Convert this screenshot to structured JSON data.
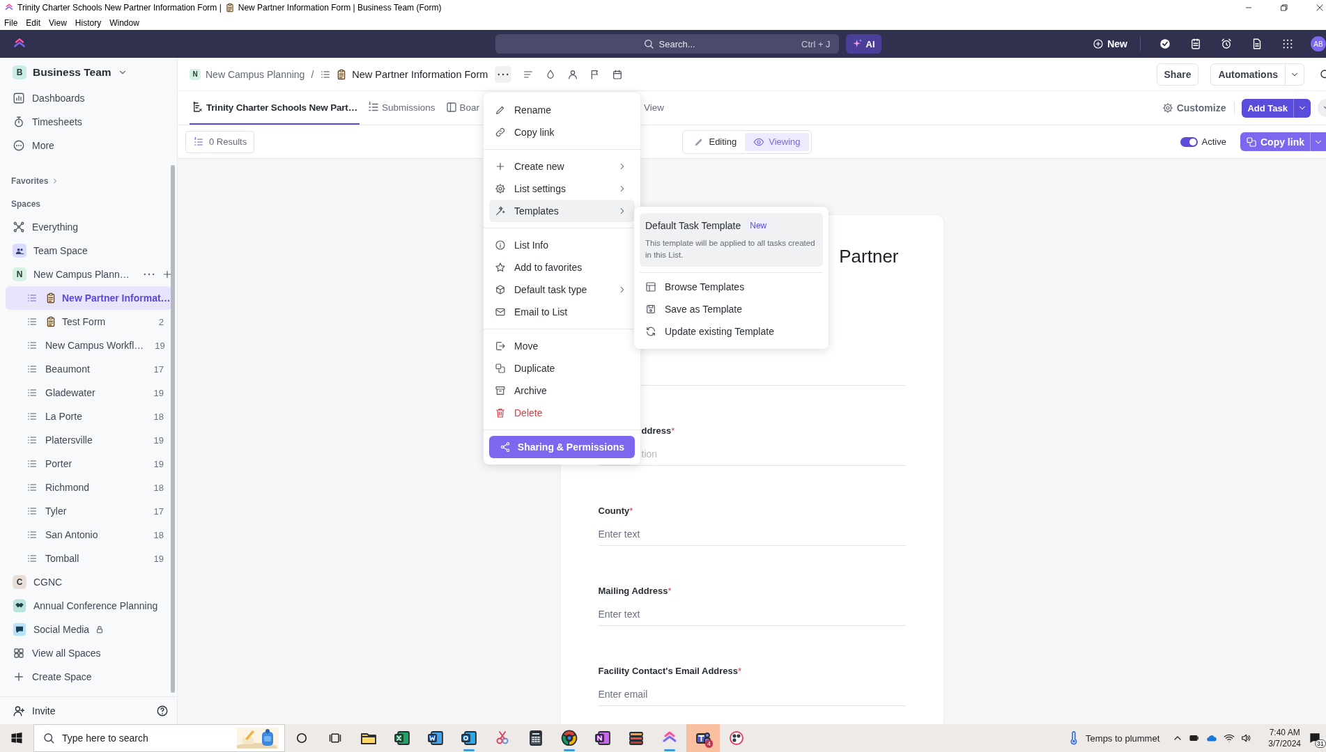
{
  "window": {
    "title_start": "Trinity Charter Schools New Partner Information Form |",
    "title_end": "New Partner Information Form | Business Team (Form)",
    "menu": [
      "File",
      "Edit",
      "View",
      "History",
      "Window"
    ]
  },
  "topbar": {
    "search": {
      "placeholder": "Search...",
      "shortcut": "Ctrl + J"
    },
    "ai_button": "AI",
    "new_button": "New",
    "avatar": "AB"
  },
  "sidebar": {
    "workspace": {
      "badge": "B",
      "name": "Business Team",
      "color": "#c9ece7"
    },
    "nav": [
      "Dashboards",
      "Timesheets",
      "More"
    ],
    "favorites_label": "Favorites",
    "spaces_label": "Spaces",
    "spaces": [
      {
        "kind": "everything",
        "name": "Everything"
      },
      {
        "kind": "space",
        "name": "Team Space"
      },
      {
        "kind": "space",
        "badge": "N",
        "color": "#d5f1e2",
        "name": "New Campus Plann…",
        "children": [
          {
            "kind": "form",
            "name": "New Partner Informat…",
            "selected": true
          },
          {
            "kind": "form",
            "name": "Test Form",
            "count": "2",
            "selected": false
          },
          {
            "kind": "list",
            "name": "New Campus Workfl…",
            "count": "19",
            "selected": false
          },
          {
            "kind": "list",
            "name": "Beaumont",
            "count": "17",
            "selected": false
          },
          {
            "kind": "list",
            "name": "Gladewater",
            "count": "19",
            "selected": false
          },
          {
            "kind": "list",
            "name": "La Porte",
            "count": "18",
            "selected": false
          },
          {
            "kind": "list",
            "name": "Platersville",
            "count": "19",
            "selected": false
          },
          {
            "kind": "list",
            "name": "Porter",
            "count": "19",
            "selected": false
          },
          {
            "kind": "list",
            "name": "Richmond",
            "count": "18",
            "selected": false
          },
          {
            "kind": "list",
            "name": "Tyler",
            "count": "17",
            "selected": false
          },
          {
            "kind": "list",
            "name": "San Antonio",
            "count": "18",
            "selected": false
          },
          {
            "kind": "list",
            "name": "Tomball",
            "count": "19",
            "selected": false
          }
        ]
      },
      {
        "kind": "space",
        "badge": "C",
        "color": "#e9ded7",
        "name": "CGNC"
      },
      {
        "kind": "space",
        "name": "Annual Conference Planning"
      },
      {
        "kind": "space",
        "name": "Social Media",
        "locked": true
      },
      {
        "kind": "action",
        "name": "View all Spaces"
      },
      {
        "kind": "action",
        "name": "Create Space"
      }
    ],
    "invite": "Invite"
  },
  "header": {
    "space_badge": "N",
    "space": "New Campus Planning",
    "separator": "/",
    "list": "New Partner Information Form",
    "share": "Share",
    "automations": "Automations"
  },
  "tabs": [
    {
      "label": "Trinity Charter Schools New Part…",
      "selected": true
    },
    {
      "label": "Submissions",
      "selected": false
    },
    {
      "label": "Boar",
      "selected": false
    },
    {
      "label": "View",
      "selected": false
    }
  ],
  "tab_actions": {
    "customize": "Customize",
    "add_task": "Add Task"
  },
  "toolbar": {
    "results": "0 Results",
    "modes": [
      {
        "label": "Editing",
        "selected": false
      },
      {
        "label": "Viewing",
        "selected": true
      }
    ],
    "active": {
      "label": "Active",
      "on": true
    },
    "copy_link": "Copy link"
  },
  "form": {
    "title": "Partner",
    "fields": [
      {
        "kind": "line"
      },
      {
        "kind": "cut",
        "label": "ddress",
        "mark": "*",
        "placeholder": "tion"
      },
      {
        "kind": "full",
        "label": "County",
        "mark": "*",
        "placeholder": "Enter text"
      },
      {
        "kind": "full",
        "label": "Mailing Address",
        "mark": "*",
        "placeholder": "Enter text"
      },
      {
        "kind": "full",
        "label": "Facility Contact's Email Address",
        "mark": "*",
        "placeholder": "Enter email"
      }
    ]
  },
  "menu": {
    "groups": [
      [
        {
          "label": "Rename",
          "kind": "normal",
          "submenu": false,
          "highlighted": false
        },
        {
          "label": "Copy link",
          "kind": "normal",
          "submenu": false,
          "highlighted": false
        }
      ],
      [
        {
          "label": "Create new",
          "kind": "normal",
          "submenu": true,
          "highlighted": false
        },
        {
          "label": "List settings",
          "kind": "normal",
          "submenu": true,
          "highlighted": false
        },
        {
          "label": "Templates",
          "kind": "normal",
          "submenu": true,
          "highlighted": true
        }
      ],
      [
        {
          "label": "List Info",
          "kind": "normal",
          "submenu": false,
          "highlighted": false
        },
        {
          "label": "Add to favorites",
          "kind": "normal",
          "submenu": false,
          "highlighted": false
        },
        {
          "label": "Default task type",
          "kind": "normal",
          "submenu": true,
          "highlighted": false
        },
        {
          "label": "Email to List",
          "kind": "normal",
          "submenu": false,
          "highlighted": false
        }
      ],
      [
        {
          "label": "Move",
          "kind": "normal",
          "submenu": false,
          "highlighted": false
        },
        {
          "label": "Duplicate",
          "kind": "normal",
          "submenu": false,
          "highlighted": false
        },
        {
          "label": "Archive",
          "kind": "normal",
          "submenu": false,
          "highlighted": false
        },
        {
          "label": "Delete",
          "kind": "danger",
          "submenu": false,
          "highlighted": false
        }
      ]
    ],
    "sharing_button": "Sharing & Permissions"
  },
  "submenu": {
    "featured": {
      "title": "Default Task Template",
      "badge": "New",
      "description": "This template will be applied to all tasks created in this List."
    },
    "items": [
      "Browse Templates",
      "Save as Template",
      "Update existing Template"
    ]
  },
  "taskbar": {
    "search_placeholder": "Type here to search",
    "apps": [
      {
        "running": false,
        "selected": false
      },
      {
        "running": false,
        "selected": false
      },
      {
        "running": false,
        "selected": false
      },
      {
        "running": true,
        "selected": false
      },
      {
        "running": false,
        "selected": false
      },
      {
        "running": false,
        "selected": false
      },
      {
        "running": true,
        "selected": false
      },
      {
        "running": false,
        "selected": false
      },
      {
        "running": false,
        "selected": false
      },
      {
        "running": true,
        "selected": false
      },
      {
        "running": false,
        "selected": true,
        "badge": "4"
      },
      {
        "running": false,
        "selected": false
      }
    ],
    "weather": "Temps to plummet",
    "time": "7:40 AM",
    "date": "3/7/2024",
    "notifications": "31"
  }
}
